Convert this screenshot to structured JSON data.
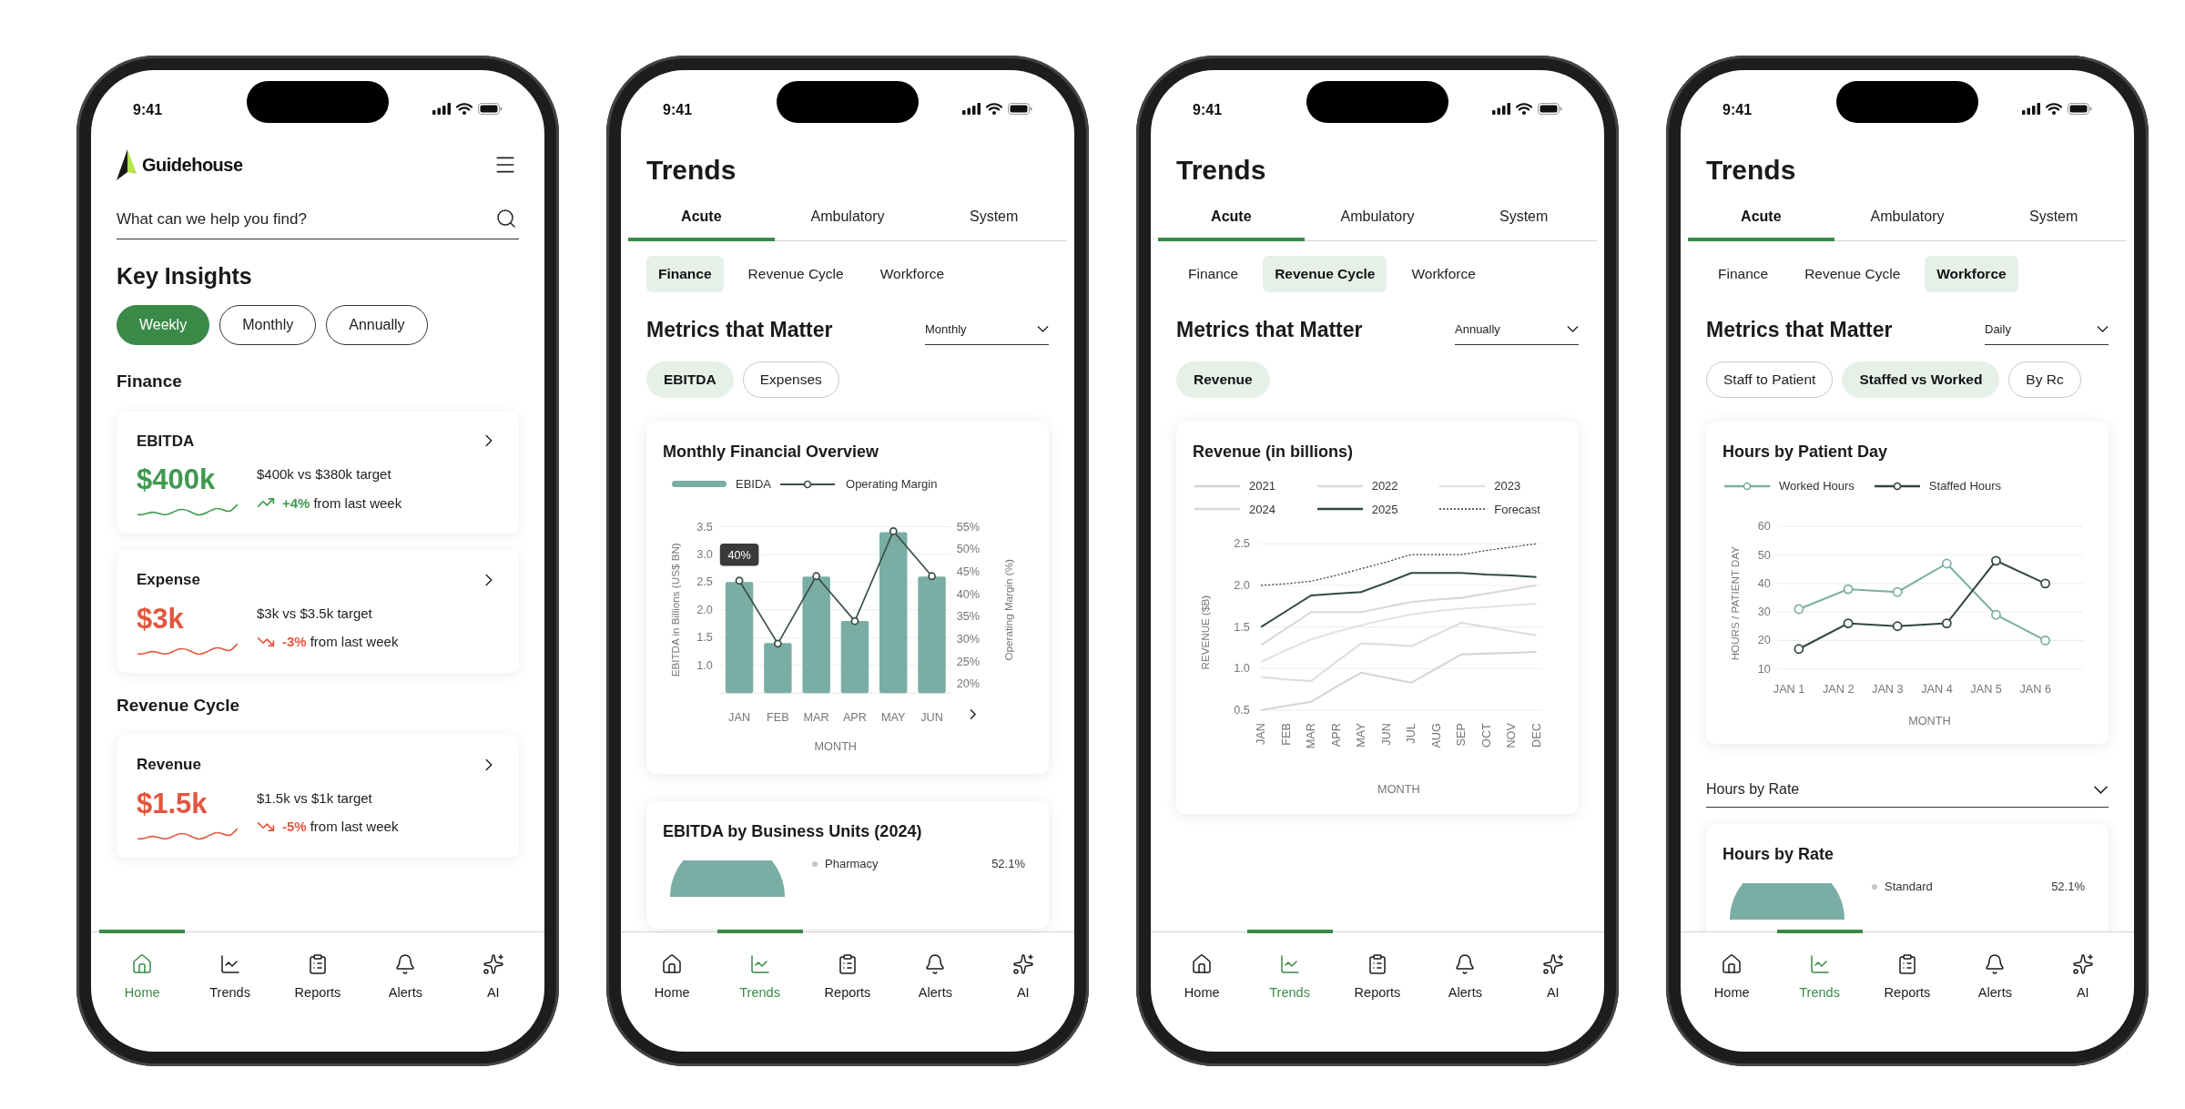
{
  "phones": [
    {
      "kind": "home",
      "status_time": "9:41",
      "brand": "Guidehouse",
      "search": {
        "placeholder": "What can we help you find?"
      },
      "title": "Key Insights",
      "periods": [
        {
          "label": "Weekly",
          "selected": true
        },
        {
          "label": "Monthly",
          "selected": false
        },
        {
          "label": "Annually",
          "selected": false
        }
      ],
      "sections": [
        {
          "title": "Finance",
          "cards": [
            {
              "title": "EBITDA",
              "value": "$400k",
              "kind": "up",
              "target": "$400k vs $380k target",
              "change": "+4%",
              "change_caption": "from last week"
            },
            {
              "title": "Expense",
              "value": "$3k",
              "kind": "down",
              "target": "$3k vs $3.5k target",
              "change": "-3%",
              "change_caption": "from last week"
            }
          ]
        },
        {
          "title": "Revenue Cycle",
          "cards": [
            {
              "title": "Revenue",
              "value": "$1.5k",
              "kind": "down",
              "target": "$1.5k vs $1k target",
              "change": "-5%",
              "change_caption": "from last week"
            }
          ]
        }
      ],
      "nav": [
        {
          "label": "Home",
          "selected": true
        },
        {
          "label": "Trends",
          "selected": false
        },
        {
          "label": "Reports",
          "selected": false
        },
        {
          "label": "Alerts",
          "selected": false
        },
        {
          "label": "AI",
          "selected": false
        }
      ]
    },
    {
      "kind": "trends",
      "status_time": "9:41",
      "title": "Trends",
      "tabs": [
        {
          "label": "Acute",
          "selected": true
        },
        {
          "label": "Ambulatory",
          "selected": false
        },
        {
          "label": "System",
          "selected": false
        }
      ],
      "categories": [
        {
          "label": "Finance",
          "selected": true
        },
        {
          "label": "Revenue Cycle",
          "selected": false
        },
        {
          "label": "Workforce",
          "selected": false
        }
      ],
      "metrics_title": "Metrics that Matter",
      "period": "Monthly",
      "chips": [
        {
          "label": "EBITDA",
          "selected": true
        },
        {
          "label": "Expenses",
          "selected": false
        }
      ],
      "chart_card": {
        "title": "Monthly Financial Overview",
        "chart_data": {
          "type": "bar",
          "grid": true,
          "legend": "top",
          "xlabel": "MONTH",
          "ylabel": "EBITDA in Billions (US$ BN)",
          "y2label": "Operating Margin (%)",
          "categories": [
            "JAN",
            "FEB",
            "MAR",
            "APR",
            "MAY",
            "JUN"
          ],
          "series": [
            {
              "name": "EBIDA",
              "type": "bar",
              "color": "#7aaea4",
              "values": [
                2.5,
                1.4,
                2.6,
                1.8,
                3.4,
                2.6
              ]
            },
            {
              "name": "Operating Margin",
              "type": "line",
              "axis": "y2",
              "marker": "circle",
              "color": "#3b4f45",
              "values": [
                43,
                29,
                44,
                34,
                54,
                44
              ]
            }
          ],
          "ylim": [
            0.5,
            3.5
          ],
          "yticks": [
            {
              "value": 1,
              "label": "1.0"
            },
            {
              "value": 1.5,
              "label": "1.5"
            },
            {
              "value": 2,
              "label": "2.0"
            },
            {
              "value": 2.5,
              "label": "2.5"
            },
            {
              "value": 3,
              "label": "3.0"
            },
            {
              "value": 3.5,
              "label": "3.5"
            }
          ],
          "y2lim": [
            18,
            55
          ],
          "y2ticks": [
            {
              "value": 20,
              "label": "20%"
            },
            {
              "value": 25,
              "label": "25%"
            },
            {
              "value": 30,
              "label": "30%"
            },
            {
              "value": 35,
              "label": "35%"
            },
            {
              "value": 40,
              "label": "40%"
            },
            {
              "value": 45,
              "label": "45%"
            },
            {
              "value": 50,
              "label": "50%"
            },
            {
              "value": 55,
              "label": "55%"
            }
          ],
          "annotations": [
            "40%"
          ]
        }
      },
      "pie_card": {
        "title": "EBITDA by Business Units (2024)",
        "legend": [
          {
            "label": "Pharmacy",
            "value": "52.1%"
          }
        ]
      },
      "nav": [
        {
          "label": "Home",
          "selected": false
        },
        {
          "label": "Trends",
          "selected": true
        },
        {
          "label": "Reports",
          "selected": false
        },
        {
          "label": "Alerts",
          "selected": false
        },
        {
          "label": "AI",
          "selected": false
        }
      ]
    },
    {
      "kind": "trends",
      "status_time": "9:41",
      "title": "Trends",
      "tabs": [
        {
          "label": "Acute",
          "selected": true
        },
        {
          "label": "Ambulatory",
          "selected": false
        },
        {
          "label": "System",
          "selected": false
        }
      ],
      "categories": [
        {
          "label": "Finance",
          "selected": false
        },
        {
          "label": "Revenue Cycle",
          "selected": true
        },
        {
          "label": "Workforce",
          "selected": false
        }
      ],
      "metrics_title": "Metrics that Matter",
      "period": "Annually",
      "chips": [
        {
          "label": "Revenue",
          "selected": true
        }
      ],
      "chart_card": {
        "title": "Revenue (in billions)",
        "chart_data": {
          "type": "line",
          "grid": true,
          "legend": "top",
          "xlabel": "MONTH",
          "ylabel": "REVENUE ($B)",
          "categories": [
            "JAN",
            "FEB",
            "MAR",
            "APR",
            "MAY",
            "JUN",
            "JUL",
            "AUG",
            "SEP",
            "OCT",
            "NOV",
            "DEC"
          ],
          "ylim": [
            0.5,
            2.5
          ],
          "yticks": [
            {
              "value": 0.5,
              "label": "0.5"
            },
            {
              "value": 1,
              "label": "1.0"
            },
            {
              "value": 1.5,
              "label": "1.5"
            },
            {
              "value": 2,
              "label": "2.0"
            },
            {
              "value": 2.5,
              "label": "2.5"
            }
          ],
          "series": [
            {
              "name": "2021",
              "color": "#d4d4d4",
              "values": [
                0.5,
                0.55,
                0.6,
                0.78,
                0.95,
                0.89,
                0.83,
                1.0,
                1.17,
                1.18,
                1.19,
                1.2
              ]
            },
            {
              "name": "2022",
              "color": "#dcdcdc",
              "values": [
                0.9,
                0.87,
                0.85,
                1.08,
                1.3,
                1.29,
                1.27,
                1.41,
                1.55,
                1.5,
                1.45,
                1.4
              ]
            },
            {
              "name": "2023",
              "color": "#e2e2e2",
              "values": [
                1.08,
                1.22,
                1.35,
                1.44,
                1.52,
                1.59,
                1.65,
                1.69,
                1.72,
                1.74,
                1.76,
                1.78
              ]
            },
            {
              "name": "2024",
              "color": "#d8d8d8",
              "values": [
                1.28,
                1.48,
                1.68,
                1.68,
                1.68,
                1.74,
                1.8,
                1.83,
                1.85,
                1.9,
                1.95,
                2.0
              ]
            },
            {
              "name": "2025",
              "color": "#2f4a3f",
              "values": [
                1.5,
                1.69,
                1.88,
                1.9,
                1.92,
                2.03,
                2.15,
                2.15,
                2.15,
                2.13,
                2.12,
                2.1
              ]
            },
            {
              "name": "Forecast",
              "color": "#333333",
              "line_style": "dotted",
              "values": [
                2.0,
                2.02,
                2.05,
                2.12,
                2.2,
                2.28,
                2.37,
                2.37,
                2.37,
                2.42,
                2.46,
                2.5
              ]
            }
          ]
        }
      },
      "nav": [
        {
          "label": "Home",
          "selected": false
        },
        {
          "label": "Trends",
          "selected": true
        },
        {
          "label": "Reports",
          "selected": false
        },
        {
          "label": "Alerts",
          "selected": false
        },
        {
          "label": "AI",
          "selected": false
        }
      ]
    },
    {
      "kind": "trends",
      "status_time": "9:41",
      "title": "Trends",
      "tabs": [
        {
          "label": "Acute",
          "selected": true
        },
        {
          "label": "Ambulatory",
          "selected": false
        },
        {
          "label": "System",
          "selected": false
        }
      ],
      "categories": [
        {
          "label": "Finance",
          "selected": false
        },
        {
          "label": "Revenue Cycle",
          "selected": false
        },
        {
          "label": "Workforce",
          "selected": true
        }
      ],
      "metrics_title": "Metrics that Matter",
      "period": "Daily",
      "chips": [
        {
          "label": "Staff to Patient",
          "selected": false
        },
        {
          "label": "Staffed vs Worked",
          "selected": true
        },
        {
          "label": "By Rc",
          "selected": false
        }
      ],
      "chart_card": {
        "title": "Hours by Patient Day",
        "chart_data": {
          "type": "line",
          "grid": true,
          "legend": "top",
          "xlabel": "MONTH",
          "ylabel": "HOURS / PATIENT DAY",
          "categories": [
            "JAN 1",
            "JAN 2",
            "JAN 3",
            "JAN 4",
            "JAN 5",
            "JAN 6"
          ],
          "ylim": [
            10,
            60
          ],
          "yticks": [
            10,
            20,
            30,
            40,
            50,
            60
          ],
          "series": [
            {
              "name": "Worked Hours",
              "marker": "circle",
              "color": "#7aaea4",
              "values": [
                31,
                38,
                37,
                47,
                29,
                20
              ]
            },
            {
              "name": "Staffed Hours",
              "marker": "circle",
              "color": "#33473e",
              "values": [
                17,
                26,
                25,
                26,
                48,
                40
              ]
            }
          ]
        }
      },
      "section_dropdown": "Hours by Rate",
      "pie_card": {
        "title": "Hours by Rate",
        "legend": [
          {
            "label": "Standard",
            "value": "52.1%"
          }
        ]
      },
      "nav": [
        {
          "label": "Home",
          "selected": false
        },
        {
          "label": "Trends",
          "selected": true
        },
        {
          "label": "Reports",
          "selected": false
        },
        {
          "label": "Alerts",
          "selected": false
        },
        {
          "label": "AI",
          "selected": false
        }
      ]
    }
  ]
}
